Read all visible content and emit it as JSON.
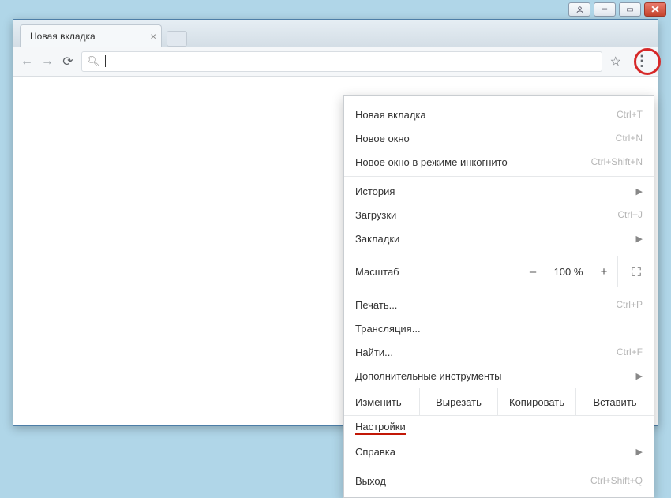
{
  "window": {
    "user_icon": "◰"
  },
  "tab": {
    "title": "Новая вкладка"
  },
  "zoom": {
    "label": "Масштаб",
    "value": "100 %",
    "minus": "–",
    "plus": "+"
  },
  "menu": {
    "new_tab": {
      "label": "Новая вкладка",
      "shortcut": "Ctrl+T"
    },
    "new_window": {
      "label": "Новое окно",
      "shortcut": "Ctrl+N"
    },
    "incognito": {
      "label": "Новое окно в режиме инкогнито",
      "shortcut": "Ctrl+Shift+N"
    },
    "history": {
      "label": "История"
    },
    "downloads": {
      "label": "Загрузки",
      "shortcut": "Ctrl+J"
    },
    "bookmarks": {
      "label": "Закладки"
    },
    "print": {
      "label": "Печать...",
      "shortcut": "Ctrl+P"
    },
    "cast": {
      "label": "Трансляция..."
    },
    "find": {
      "label": "Найти...",
      "shortcut": "Ctrl+F"
    },
    "more_tools": {
      "label": "Дополнительные инструменты"
    },
    "edit": {
      "label": "Изменить",
      "cut": "Вырезать",
      "copy": "Копировать",
      "paste": "Вставить"
    },
    "settings": {
      "label": "Настройки"
    },
    "help": {
      "label": "Справка"
    },
    "exit": {
      "label": "Выход",
      "shortcut": "Ctrl+Shift+Q"
    }
  }
}
